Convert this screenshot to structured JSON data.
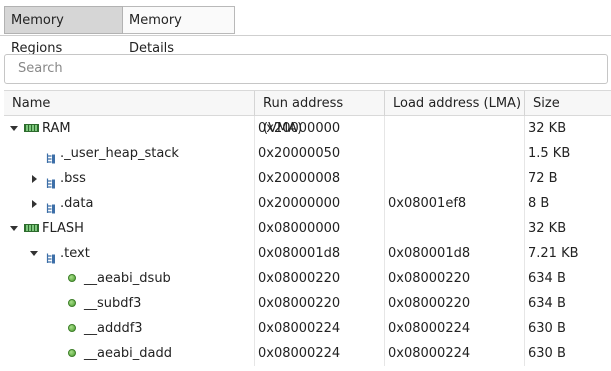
{
  "tabs": [
    {
      "label": "Memory Regions",
      "active": true
    },
    {
      "label": "Memory Details",
      "active": false
    }
  ],
  "search": {
    "placeholder": "Search",
    "value": ""
  },
  "columns": [
    "Name",
    "Run address (VMA)",
    "Load address (LMA)",
    "Size"
  ],
  "rows": [
    {
      "name": "RAM",
      "vma": "0x20000000",
      "lma": "",
      "size": "32 KB",
      "icon": "memory-region-icon",
      "level": 0,
      "expander": "expanded"
    },
    {
      "name": "._user_heap_stack",
      "vma": "0x20000050",
      "lma": "",
      "size": "1.5 KB",
      "icon": "section-icon",
      "level": 1,
      "expander": "none"
    },
    {
      "name": ".bss",
      "vma": "0x20000008",
      "lma": "",
      "size": "72 B",
      "icon": "section-icon",
      "level": 1,
      "expander": "collapsed"
    },
    {
      "name": ".data",
      "vma": "0x20000000",
      "lma": "0x08001ef8",
      "size": "8 B",
      "icon": "section-icon",
      "level": 1,
      "expander": "collapsed"
    },
    {
      "name": "FLASH",
      "vma": "0x08000000",
      "lma": "",
      "size": "32 KB",
      "icon": "memory-region-icon",
      "level": 0,
      "expander": "expanded"
    },
    {
      "name": ".text",
      "vma": "0x080001d8",
      "lma": "0x080001d8",
      "size": "7.21 KB",
      "icon": "section-icon",
      "level": 1,
      "expander": "expanded"
    },
    {
      "name": "__aeabi_dsub",
      "vma": "0x08000220",
      "lma": "0x08000220",
      "size": "634 B",
      "icon": "symbol-icon",
      "level": 2,
      "expander": "none"
    },
    {
      "name": "__subdf3",
      "vma": "0x08000220",
      "lma": "0x08000220",
      "size": "634 B",
      "icon": "symbol-icon",
      "level": 2,
      "expander": "none"
    },
    {
      "name": "__adddf3",
      "vma": "0x08000224",
      "lma": "0x08000224",
      "size": "630 B",
      "icon": "symbol-icon",
      "level": 2,
      "expander": "none"
    },
    {
      "name": "__aeabi_dadd",
      "vma": "0x08000224",
      "lma": "0x08000224",
      "size": "630 B",
      "icon": "symbol-icon",
      "level": 2,
      "expander": "none"
    }
  ],
  "colors": {
    "accent_green": "#4a9a2e",
    "section_blue": "#3d6fa8",
    "tab_active": "#d6d6d6"
  }
}
